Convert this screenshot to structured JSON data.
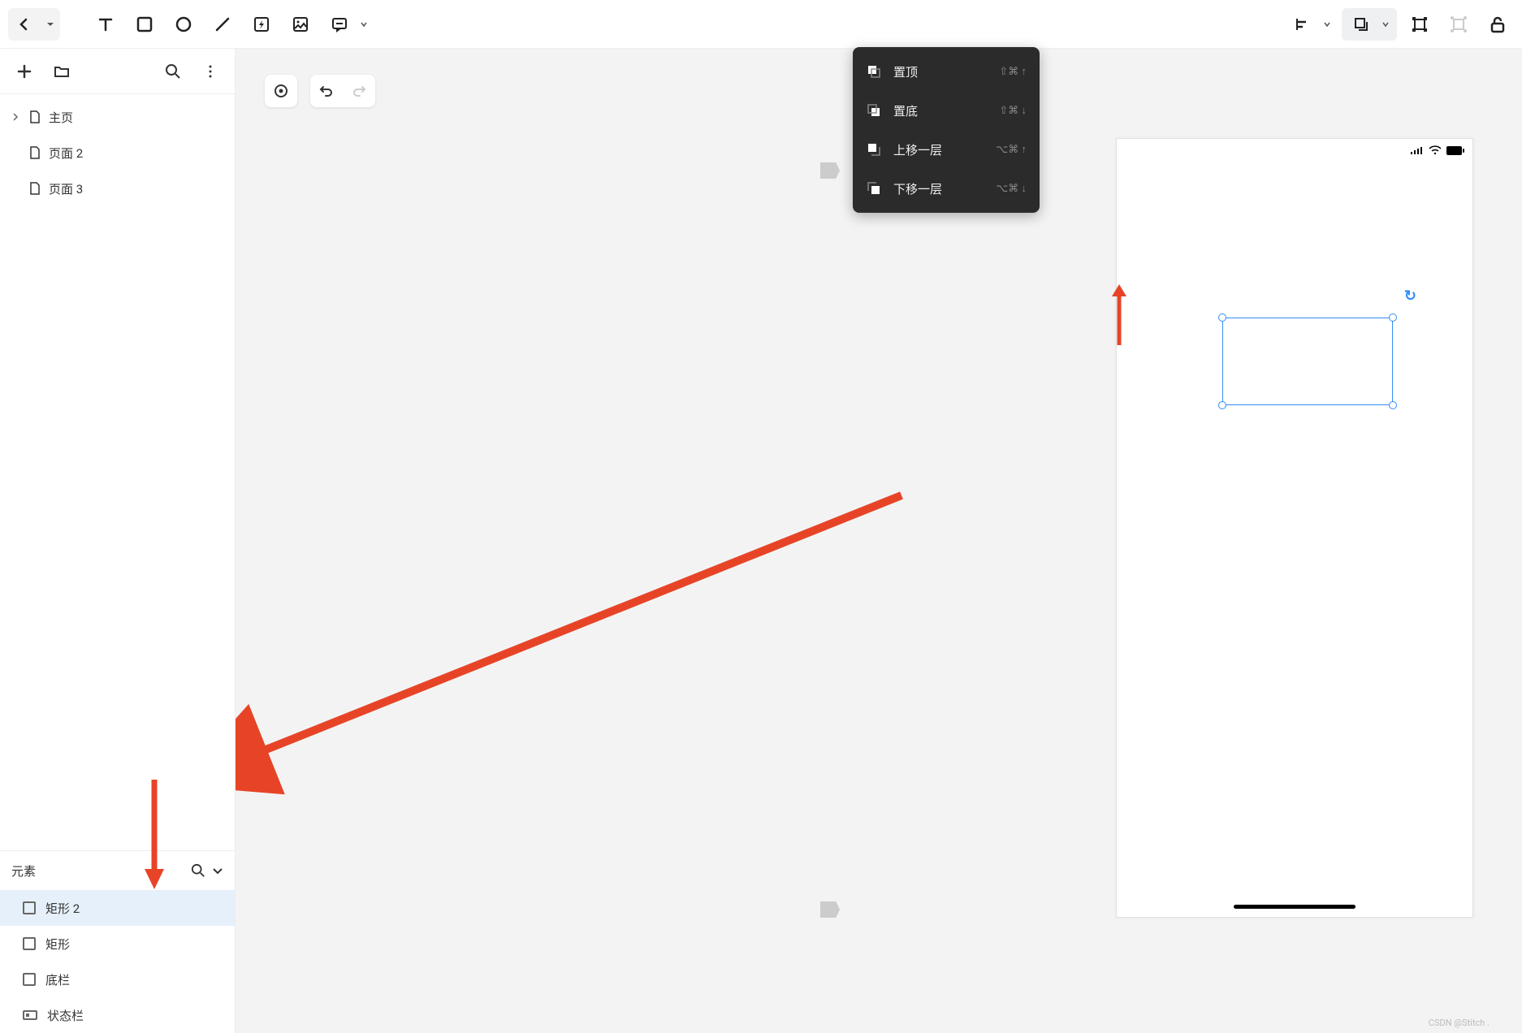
{
  "toolbar": {
    "back_icon": "back-icon",
    "dropdown_icon": "dropdown-icon"
  },
  "sidebar": {
    "pages": [
      {
        "name": "主页",
        "has_children": true
      },
      {
        "name": "页面 2",
        "has_children": false
      },
      {
        "name": "页面 3",
        "has_children": false
      }
    ],
    "elements_title": "元素",
    "elements": [
      {
        "name": "矩形 2",
        "type": "rect",
        "selected": true
      },
      {
        "name": "矩形",
        "type": "rect",
        "selected": false
      },
      {
        "name": "底栏",
        "type": "rect",
        "selected": false
      },
      {
        "name": "状态栏",
        "type": "bar",
        "selected": false
      }
    ]
  },
  "layer_menu": {
    "items": [
      {
        "label": "置顶",
        "shortcut": "⇧⌘ ↑"
      },
      {
        "label": "置底",
        "shortcut": "⇧⌘ ↓"
      },
      {
        "label": "上移一层",
        "shortcut": "⌥⌘ ↑"
      },
      {
        "label": "下移一层",
        "shortcut": "⌥⌘ ↓"
      }
    ]
  },
  "watermark": "CSDN @Stitch ."
}
